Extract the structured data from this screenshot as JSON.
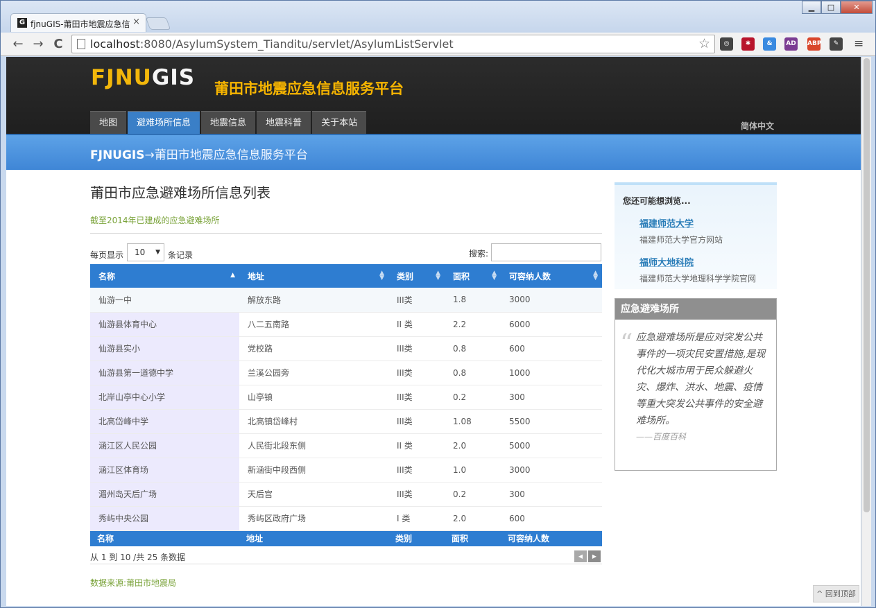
{
  "browser": {
    "tab_title": "fjnuGIS-莆田市地震应急信",
    "tab_close": "×",
    "favicon_letter": "G",
    "url_host": "localhost",
    "url_rest": ":8080/AsylumSystem_Tianditu/servlet/AsylumListServlet",
    "back_icon": "←",
    "forward_icon": "→",
    "reload_icon": "C",
    "star_icon": "☆",
    "menu_icon": "≡",
    "window_buttons": [
      "▁",
      "□",
      "✕"
    ],
    "extensions": [
      {
        "name": "steering-wheel-extension",
        "label": "◎",
        "color": "#444444"
      },
      {
        "name": "evernote-extension",
        "label": "✱",
        "color": "#b8142b"
      },
      {
        "name": "baidu-extension",
        "label": "&",
        "color": "#3a8ae0"
      },
      {
        "name": "issuu-adblock-extension",
        "label": "AD",
        "color": "#7b3c92"
      },
      {
        "name": "adblock-plus-extension",
        "label": "ABP",
        "color": "#d9462b"
      },
      {
        "name": "evernote-clip-extension",
        "label": "✎",
        "color": "#444444"
      }
    ]
  },
  "header": {
    "logo_accent": "FJNU",
    "logo_rest": "GIS",
    "site_title": "莆田市地震应急信息服务平台",
    "nav": [
      "地图",
      "避难场所信息",
      "地震信息",
      "地震科普",
      "关于本站"
    ],
    "nav_active_index": 1,
    "lang_switch": "简体中文",
    "accent_color": "#f7b500",
    "active_nav_color": "#3a7fc7"
  },
  "banner": {
    "brand": "FJNUGIS",
    "arrow": "→",
    "text": "莆田市地震应急信息服务平台"
  },
  "main": {
    "heading": "莆田市应急避难场所信息列表",
    "note": "截至2014年已建成的应急避难场所",
    "length_label": "每页显示",
    "length_value": "10",
    "length_suffix": "条记录",
    "search_label": "搜索:",
    "search_value": "",
    "columns": [
      "名称",
      "地址",
      "类别",
      "面积",
      "可容纳人数"
    ],
    "rows": [
      [
        "仙游一中",
        "解放东路",
        "III类",
        "1.8",
        "3000"
      ],
      [
        "仙游县体育中心",
        "八二五南路",
        "II 类",
        "2.2",
        "6000"
      ],
      [
        "仙游县实小",
        "党校路",
        "III类",
        "0.8",
        "600"
      ],
      [
        "仙游县第一道德中学",
        "兰溪公园旁",
        "III类",
        "0.8",
        "1000"
      ],
      [
        "北岸山亭中心小学",
        "山亭镇",
        "III类",
        "0.2",
        "300"
      ],
      [
        "北高岱峰中学",
        "北高镇岱峰村",
        "III类",
        "1.08",
        "5500"
      ],
      [
        "涵江区人民公园",
        "人民街北段东侧",
        "II 类",
        "2.0",
        "5000"
      ],
      [
        "涵江区体育场",
        "新涵街中段西侧",
        "III类",
        "1.0",
        "3000"
      ],
      [
        "湄州岛天后广场",
        "天后宫",
        "III类",
        "0.2",
        "300"
      ],
      [
        "秀屿中央公园",
        "秀屿区政府广场",
        "I 类",
        "2.0",
        "600"
      ]
    ],
    "info": "从 1 到 10 /共 25 条数据",
    "prev": "◀",
    "next": "▶",
    "source": "数据来源:莆田市地震局",
    "table_header_color": "#2e7dd1"
  },
  "sidebar": {
    "suggest_title": "您还可能想浏览...",
    "links": [
      {
        "title": "福建师范大学",
        "desc": "福建师范大学官方网站"
      },
      {
        "title": "福师大地科院",
        "desc": "福建师范大学地理科学学院官网"
      }
    ],
    "quote_title": "应急避难场所",
    "quote_mark": "“",
    "quote_text": "应急避难场所是应对突发公共事件的一项灾民安置措施,是现代化大城市用于民众躲避火灾、爆炸、洪水、地震、疫情等重大突发公共事件的安全避难场所。",
    "quote_cite": "——百度百科"
  },
  "back_to_top": "^ 回到顶部"
}
